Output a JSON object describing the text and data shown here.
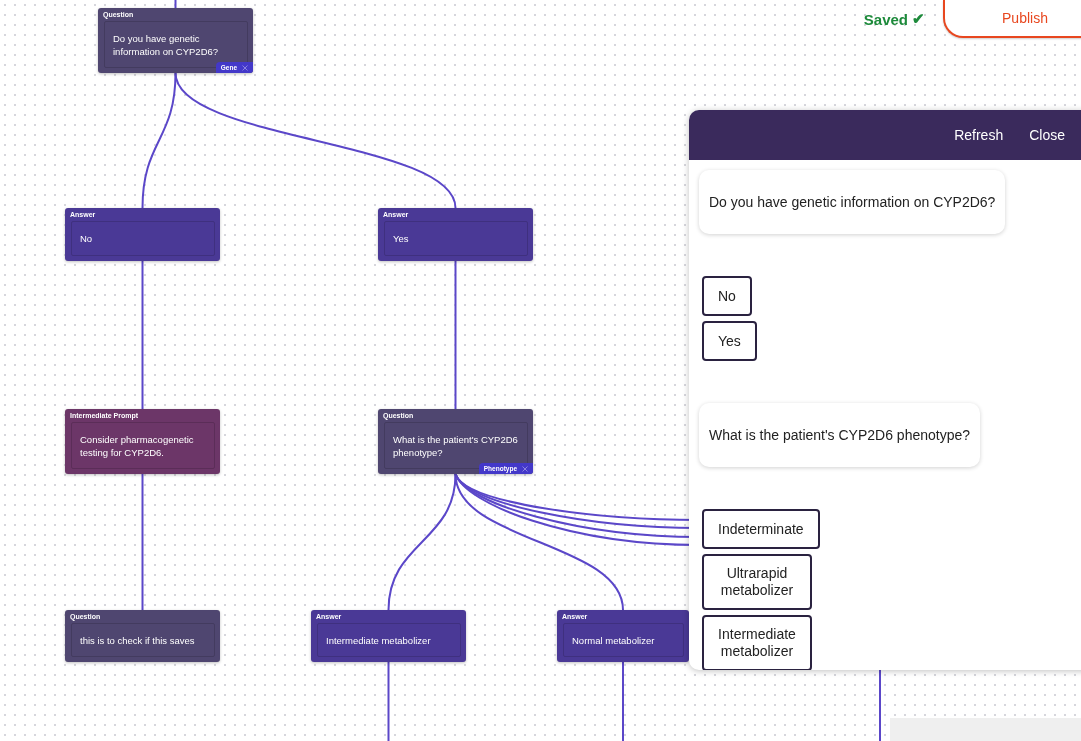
{
  "toolbar": {
    "status": "Saved",
    "status_icon": "✔",
    "publish": "Publish"
  },
  "nodes": [
    {
      "kind": "question",
      "type_label": "Question",
      "text": "Do you have genetic information on CYP2D6?",
      "tag": "Gene"
    },
    {
      "kind": "answer",
      "type_label": "Answer",
      "text": "No"
    },
    {
      "kind": "answer",
      "type_label": "Answer",
      "text": "Yes"
    },
    {
      "kind": "prompt",
      "type_label": "Intermediate Prompt",
      "text": "Consider pharmacogenetic testing for CYP2D6."
    },
    {
      "kind": "question",
      "type_label": "Question",
      "text": "What is the patient's CYP2D6 phenotype?",
      "tag": "Phenotype"
    },
    {
      "kind": "question",
      "type_label": "Question",
      "text": "this is to check if this saves"
    },
    {
      "kind": "answer",
      "type_label": "Answer",
      "text": "Intermediate metabolizer"
    },
    {
      "kind": "answer",
      "type_label": "Answer",
      "text": "Normal metabolizer"
    }
  ],
  "preview": {
    "actions": [
      "Refresh",
      "Close"
    ],
    "messages": [
      {
        "kind": "bubble",
        "text": "Do you have genetic information on CYP2D6?"
      },
      {
        "kind": "options",
        "options": [
          "No",
          "Yes"
        ]
      },
      {
        "kind": "bubble",
        "text": "What is the patient's CYP2D6 phenotype?"
      },
      {
        "kind": "options",
        "options": [
          "Indeterminate",
          "Ultrarapid metabolizer",
          "Intermediate metabolizer"
        ]
      }
    ]
  }
}
